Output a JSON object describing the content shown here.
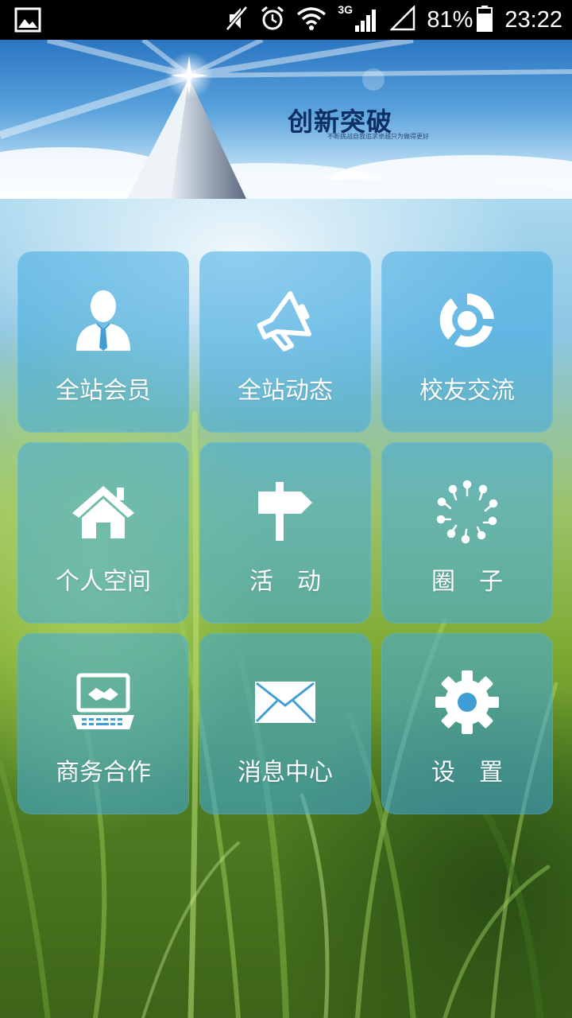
{
  "status_bar": {
    "battery_percent": "81%",
    "time": "23:22",
    "network_type": "3G",
    "icons": [
      "image-icon",
      "mute-icon",
      "alarm-icon",
      "wifi-icon",
      "signal-icon",
      "signal-empty-icon",
      "battery-icon"
    ]
  },
  "banner": {
    "title": "创新突破",
    "subtitle": "不断挑战自我追求卓越只为做得更好"
  },
  "menu": {
    "items": [
      {
        "label": "全站会员",
        "icon": "member-icon"
      },
      {
        "label": "全站动态",
        "icon": "megaphone-icon"
      },
      {
        "label": "校友交流",
        "icon": "exchange-icon"
      },
      {
        "label": "个人空间",
        "icon": "home-icon"
      },
      {
        "label": "活　动",
        "icon": "signpost-icon"
      },
      {
        "label": "圈　子",
        "icon": "circle-people-icon"
      },
      {
        "label": "商务合作",
        "icon": "handshake-laptop-icon"
      },
      {
        "label": "消息中心",
        "icon": "envelope-icon"
      },
      {
        "label": "设　置",
        "icon": "gear-icon"
      }
    ]
  },
  "colors": {
    "tile_bg": "#40aae1",
    "tile_text": "#ffffff",
    "status_bar_bg": "#000000"
  }
}
